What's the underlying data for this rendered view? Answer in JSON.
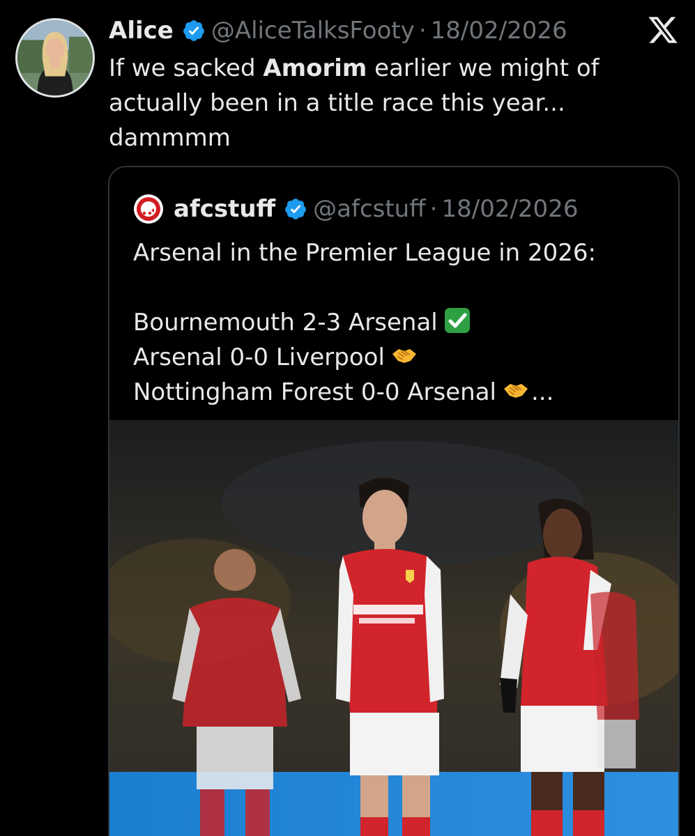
{
  "tweet": {
    "author_name": "Alice",
    "handle": "@AliceTalksFooty",
    "separator": "·",
    "date": "18/02/2026",
    "text_line1_pre": "If we sacked ",
    "text_line1_bold": "Amorim",
    "text_line1_post": " earlier we might of",
    "text_line2": "actually been in a title race this year...",
    "text_line3": "dammmm"
  },
  "icons": {
    "verified": "verified-badge-icon",
    "platform_logo": "x-logo-icon",
    "check_emoji": "check-mark-button-emoji",
    "handshake_emoji": "handshake-emoji"
  },
  "quoted": {
    "author_name": "afcstuff",
    "handle": "@afcstuff",
    "separator": "·",
    "date": "18/02/2026",
    "line1": "Arsenal in the Premier League in 2026:",
    "results": [
      "Bournemouth 2-3 Arsenal",
      "Arsenal 0-0 Liverpool",
      "Nottingham Forest 0-0 Arsenal"
    ],
    "ellipsis": "..."
  },
  "colors": {
    "background": "#000000",
    "primary_text": "#e7e9ea",
    "secondary_text": "#71767b",
    "verified_blue": "#1d9bf0",
    "card_border": "#2f3336",
    "arsenal_red": "#d11d22"
  }
}
